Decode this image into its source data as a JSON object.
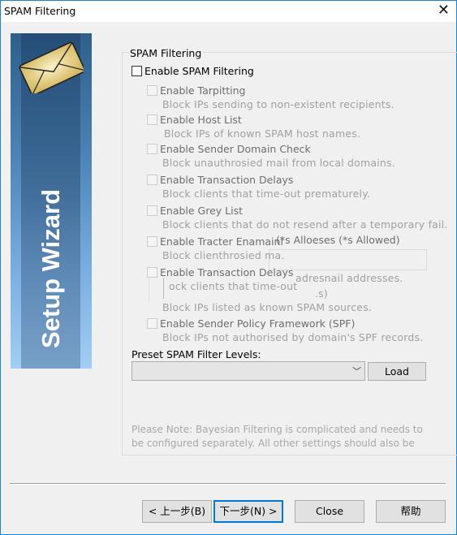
{
  "window": {
    "title": "SPAM Filtering",
    "close_icon": "close-icon"
  },
  "banner": {
    "text": "Setup Wizard",
    "icon": "envelope-icon"
  },
  "group": {
    "legend": "SPAM Filtering",
    "master": {
      "label": "Enable SPAM Filtering",
      "checked": false,
      "enabled": true
    },
    "options": [
      {
        "label": "Enable Tarpitting",
        "desc": "Block IPs sending to non-existent recipients.",
        "checked": false,
        "enabled": false
      },
      {
        "label": "Enable Host List",
        "desc": "Block IPs of known SPAM host names.",
        "checked": false,
        "enabled": false
      },
      {
        "label": "Enable Sender Domain Check",
        "desc": "Block unauthrosied mail from local domains.",
        "checked": false,
        "enabled": false
      },
      {
        "label": "Enable Transaction Delays",
        "desc": "Block clients that time-out prematurely.",
        "checked": false,
        "enabled": false
      },
      {
        "label": "Enable Grey List",
        "desc": "Block clients that do not resend after a temporary fail.",
        "checked": false,
        "enabled": false
      },
      {
        "label": "Enable Tracter Enamainl",
        "desc": "Block clienthrosied ma.",
        "checked": false,
        "enabled": false
      },
      {
        "label": "Enable Transaction Delays",
        "desc": "ock clients that time-out",
        "checked": false,
        "enabled": false
      },
      {
        "label": "",
        "desc": "Block IPs listed as known SPAM sources.",
        "checked": false,
        "enabled": false
      },
      {
        "label": "Enable Sender Policy Framework (SPF)",
        "desc": "Block IPs not authorised by domain's SPF records.",
        "checked": false,
        "enabled": false
      }
    ],
    "ghost_texts": {
      "allowed": "(*s Alloeses (*s Allowed)",
      "addresses": "adresnail addresses.",
      "paren": ".s)"
    },
    "preset": {
      "label": "Preset SPAM Filter Levels:",
      "selected": "",
      "load_label": "Load"
    },
    "note": "Please Note: Bayesian Filtering is complicated and needs to be configured separately. All other settings should also be"
  },
  "footer": {
    "back_label": "< 上一步(B)",
    "next_label": "下一步(N) >",
    "close_label": "Close",
    "help_label": "帮助"
  },
  "colors": {
    "accent": "#0078d7",
    "window_border": "#1883d7",
    "disabled_text": "#a0a0a0"
  }
}
